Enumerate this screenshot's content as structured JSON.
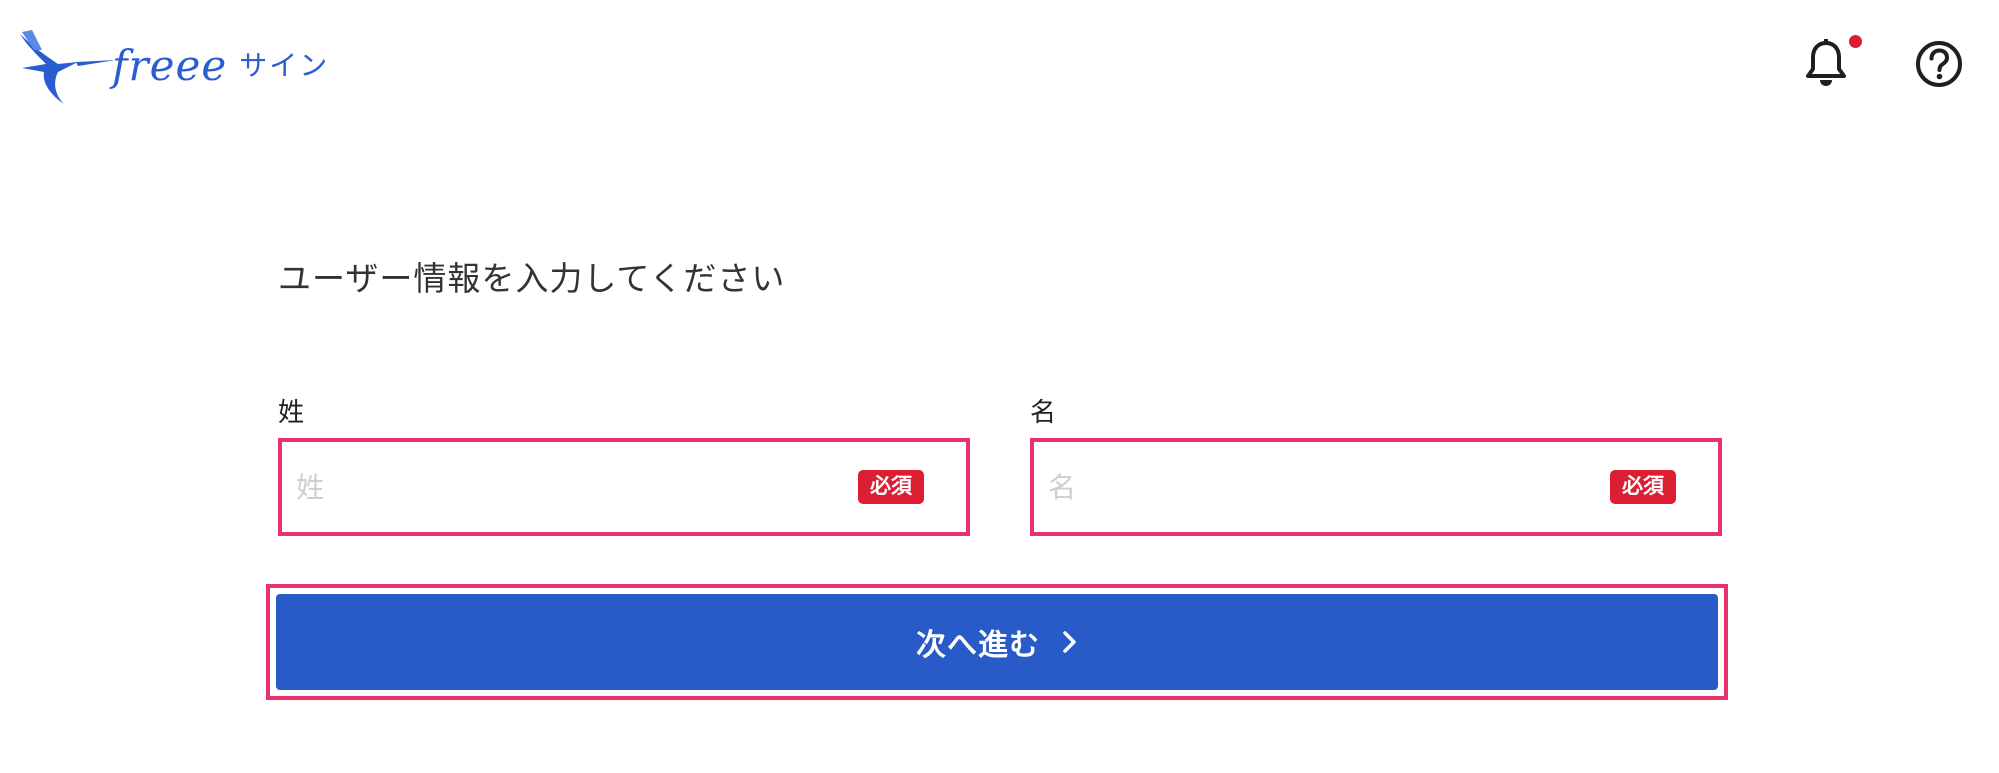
{
  "header": {
    "logo_text": "freee",
    "logo_sub": "サイン",
    "icons": {
      "notification": "bell-icon",
      "help": "help-circle-icon"
    },
    "colors": {
      "brand": "#2a5dd1",
      "notification_dot": "#dc1e32"
    }
  },
  "form": {
    "title": "ユーザー情報を入力してください",
    "last_name": {
      "label": "姓",
      "placeholder": "姓",
      "value": "",
      "required_badge": "必須"
    },
    "first_name": {
      "label": "名",
      "placeholder": "名",
      "value": "",
      "required_badge": "必須"
    },
    "submit": {
      "label": "次へ進む",
      "icon": "chevron-right-icon"
    },
    "colors": {
      "primary": "#285ac8",
      "required": "#dc1e32",
      "highlight": "#e8336d"
    }
  }
}
